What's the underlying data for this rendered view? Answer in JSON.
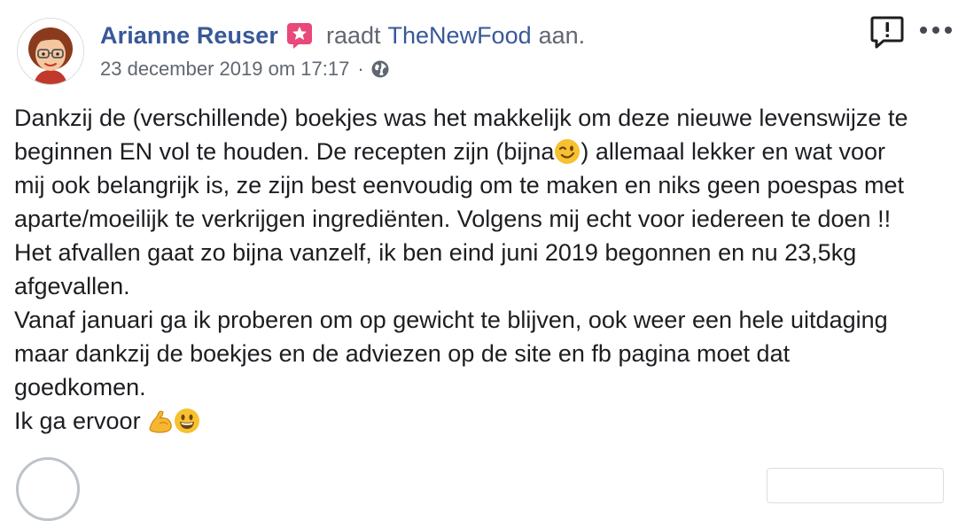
{
  "post": {
    "author_name": "Arianne Reuser",
    "author_badge_icon": "star-badge-icon",
    "action_text": "raadt",
    "page_name": "TheNewFood",
    "action_suffix": "aan.",
    "timestamp": "23 december 2019 om 17:17",
    "separator": "·",
    "privacy_icon": "globe-icon",
    "report_icon": "report-icon",
    "more_icon": "more-options-icon",
    "body_lines": [
      "Dankzij de (verschillende) boekjes was het makkelijk om deze nieuwe levenswijze te",
      "beginnen EN vol te houden. De recepten zijn (bijna",
      ") allemaal lekker en wat voor",
      "mij ook belangrijk is, ze zijn best eenvoudig om te maken en niks geen poespas met",
      "aparte/moeilijk te verkrijgen ingrediënten. Volgens mij echt voor iedereen te doen !!",
      "Het afvallen gaat zo bijna vanzelf, ik ben eind juni 2019 begonnen en nu 23,5kg",
      "afgevallen.",
      "Vanaf januari ga ik proberen om op gewicht te blijven, ook weer een hele uitdaging",
      "maar dankzij de boekjes en de adviezen op de site en fb pagina moet dat",
      "goedkomen.",
      "Ik ga ervoor "
    ],
    "emoji": {
      "wink": "winking-face-emoji",
      "muscle": "flexed-biceps-emoji",
      "grin": "grinning-face-emoji"
    }
  },
  "colors": {
    "link": "#385898",
    "secondary_text": "#606770",
    "primary_text": "#1c1e21",
    "badge": "#e8487a"
  }
}
